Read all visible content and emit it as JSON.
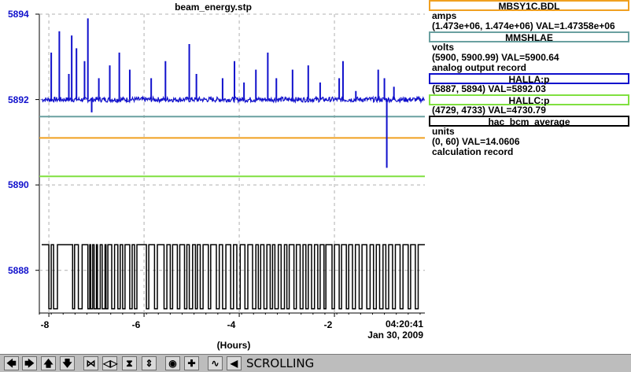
{
  "plot": {
    "title": "beam_energy.stp",
    "y_ticks": [
      "5894",
      "5892",
      "5890",
      "5888"
    ],
    "x_ticks": [
      "-8",
      "-6",
      "-4",
      "-2"
    ],
    "time_label": "04:20:41",
    "date_label": "Jan 30, 2009",
    "xlabel": "(Hours)"
  },
  "legend": [
    {
      "name": "MBSY1C.BDL",
      "units": "amps",
      "range_val": "(1.473e+06, 1.474e+06)  VAL=1.47358e+06",
      "color": "#f0a020"
    },
    {
      "name": "MMSHLAE",
      "units": "volts",
      "range_val": "(5900, 5900.99) VAL=5900.64",
      "description": "analog output record",
      "color": "#6aa0a0"
    },
    {
      "name": "HALLA:p",
      "range_val": "(5887, 5894) VAL=5892.03",
      "color": "#1010cc"
    },
    {
      "name": "HALLC:p",
      "range_val": "(4729, 4733) VAL=4730.79",
      "color": "#80e040"
    },
    {
      "name": "hac_bcm_average",
      "units": "units",
      "range_val": "(0, 60) VAL=14.0606",
      "description": "calculation record",
      "color": "#000000"
    }
  ],
  "toolbar": {
    "status": "SCROLLING"
  },
  "chart_data": {
    "type": "line",
    "title": "beam_energy.stp",
    "xlabel": "(Hours)",
    "ylabel": "",
    "xlim": [
      -8.2,
      -0.1
    ],
    "ylim": [
      5887,
      5894
    ],
    "x_ticks": [
      -8,
      -6,
      -4,
      -2
    ],
    "y_ticks": [
      5894,
      5892,
      5890,
      5888
    ],
    "grid": true,
    "series": [
      {
        "name": "HALLA:p",
        "color": "#1010cc",
        "baseline": 5892.0,
        "spikes": [
          [
            -7.95,
            5893.1
          ],
          [
            -7.78,
            5893.6
          ],
          [
            -7.58,
            5892.6
          ],
          [
            -7.52,
            5893.5
          ],
          [
            -7.42,
            5893.2
          ],
          [
            -7.25,
            5892.9
          ],
          [
            -7.18,
            5893.9
          ],
          [
            -7.1,
            5891.7
          ],
          [
            -6.95,
            5892.5
          ],
          [
            -6.72,
            5892.8
          ],
          [
            -6.52,
            5893.1
          ],
          [
            -6.3,
            5892.7
          ],
          [
            -5.85,
            5892.5
          ],
          [
            -5.55,
            5892.9
          ],
          [
            -5.05,
            5893.3
          ],
          [
            -4.9,
            5892.6
          ],
          [
            -4.35,
            5892.5
          ],
          [
            -4.1,
            5892.9
          ],
          [
            -3.9,
            5892.4
          ],
          [
            -3.65,
            5892.7
          ],
          [
            -3.4,
            5893.1
          ],
          [
            -3.22,
            5892.5
          ],
          [
            -2.88,
            5892.7
          ],
          [
            -2.55,
            5892.8
          ],
          [
            -2.3,
            5892.4
          ],
          [
            -1.9,
            5892.5
          ],
          [
            -1.82,
            5892.9
          ],
          [
            -1.55,
            5892.2
          ],
          [
            -1.08,
            5892.7
          ],
          [
            -0.95,
            5892.5
          ],
          [
            -0.9,
            5890.4
          ],
          [
            -0.75,
            5892.3
          ]
        ]
      },
      {
        "name": "MMSHLAE",
        "color": "#6aa0a0",
        "y": 5891.6
      },
      {
        "name": "MBSY1C.BDL",
        "color": "#f0a020",
        "y": 5891.1
      },
      {
        "name": "HALLC:p",
        "color": "#80e040",
        "y": 5890.2
      },
      {
        "name": "hac_bcm_average",
        "color": "#000000",
        "high": 5888.6,
        "low": 5887.1,
        "dropouts": [
          [
            -8.0,
            -7.95
          ],
          [
            -7.9,
            -7.82
          ],
          [
            -7.5,
            -7.46
          ],
          [
            -7.38,
            -7.3
          ],
          [
            -7.18,
            -7.14
          ],
          [
            -7.12,
            -7.08
          ],
          [
            -7.05,
            -7.0
          ],
          [
            -6.98,
            -6.92
          ],
          [
            -6.88,
            -6.82
          ],
          [
            -6.8,
            -6.76
          ],
          [
            -6.68,
            -6.62
          ],
          [
            -6.55,
            -6.5
          ],
          [
            -6.45,
            -6.4
          ],
          [
            -6.3,
            -6.25
          ],
          [
            -6.2,
            -6.15
          ],
          [
            -5.95,
            -5.9
          ],
          [
            -5.78,
            -5.72
          ],
          [
            -5.58,
            -5.52
          ],
          [
            -5.45,
            -5.4
          ],
          [
            -5.3,
            -5.25
          ],
          [
            -5.15,
            -5.1
          ],
          [
            -5.05,
            -4.98
          ],
          [
            -4.92,
            -4.88
          ],
          [
            -4.82,
            -4.76
          ],
          [
            -4.65,
            -4.6
          ],
          [
            -4.48,
            -4.42
          ],
          [
            -4.35,
            -4.28
          ],
          [
            -4.18,
            -4.12
          ],
          [
            -4.05,
            -3.98
          ],
          [
            -3.88,
            -3.82
          ],
          [
            -3.72,
            -3.65
          ],
          [
            -3.6,
            -3.55
          ],
          [
            -3.48,
            -3.42
          ],
          [
            -3.35,
            -3.3
          ],
          [
            -3.25,
            -3.18
          ],
          [
            -3.12,
            -3.05
          ],
          [
            -3.0,
            -2.95
          ],
          [
            -2.85,
            -2.8
          ],
          [
            -2.72,
            -2.66
          ],
          [
            -2.6,
            -2.55
          ],
          [
            -2.48,
            -2.42
          ],
          [
            -2.35,
            -2.3
          ],
          [
            -2.22,
            -2.18
          ],
          [
            -2.05,
            -2.0
          ],
          [
            -1.9,
            -1.85
          ],
          [
            -1.75,
            -1.7
          ],
          [
            -1.62,
            -1.56
          ],
          [
            -1.48,
            -1.42
          ],
          [
            -1.32,
            -1.25
          ],
          [
            -1.18,
            -1.12
          ],
          [
            -1.05,
            -0.98
          ],
          [
            -0.92,
            -0.86
          ],
          [
            -0.78,
            -0.72
          ],
          [
            -0.62,
            -0.56
          ],
          [
            -0.45,
            -0.4
          ],
          [
            -0.3,
            -0.24
          ]
        ]
      }
    ]
  }
}
